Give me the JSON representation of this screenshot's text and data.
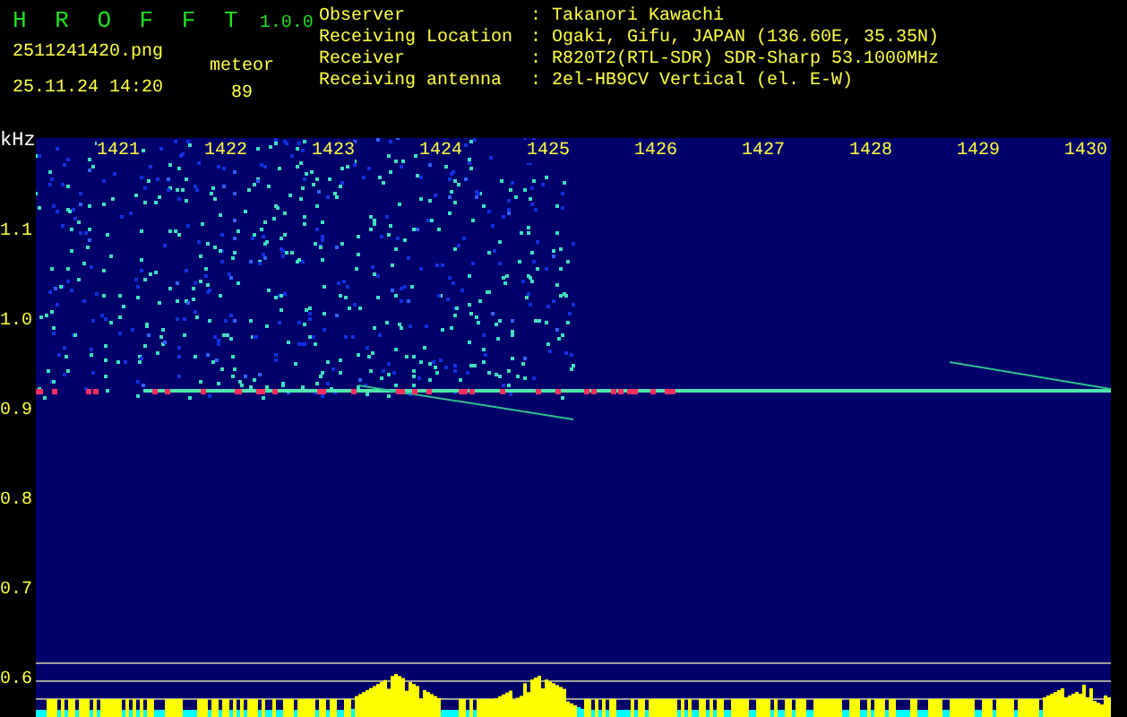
{
  "app": {
    "name": "H R O F F T",
    "version": "1.0.0"
  },
  "file": {
    "name": "2511241420.png",
    "datetime": "25.11.24 14:20"
  },
  "meteor": {
    "label": "meteor",
    "count": "89"
  },
  "info": [
    {
      "label": "Observer",
      "value": ": Takanori Kawachi"
    },
    {
      "label": "Receiving Location",
      "value": ": Ogaki, Gifu, JAPAN (136.60E, 35.35N)"
    },
    {
      "label": "Receiver",
      "value": ": R820T2(RTL-SDR) SDR-Sharp 53.1000MHz"
    },
    {
      "label": "Receiving antenna",
      "value": ": 2el-HB9CV Vertical (el. E-W)"
    }
  ],
  "plot": {
    "unit": "kHz",
    "x_labels": [
      "1421",
      "1422",
      "1423",
      "1424",
      "1425",
      "1426",
      "1427",
      "1428",
      "1429",
      "1430"
    ],
    "y_labels": [
      "1.1",
      "1.0",
      "0.9",
      "0.8",
      "0.7",
      "0.6"
    ]
  }
}
